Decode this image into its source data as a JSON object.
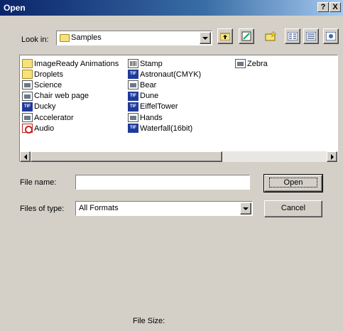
{
  "window": {
    "title": "Open",
    "help_btn": "?",
    "close_btn": "X"
  },
  "look_in": {
    "label": "Look in:",
    "value": "Samples"
  },
  "toolbar": {
    "icons": [
      "up-folder-icon",
      "desktop-icon",
      "new-folder-icon",
      "list-view-icon",
      "details-view-icon",
      "thumbnails-icon"
    ]
  },
  "files": {
    "column1": [
      {
        "name": "ImageReady Animations",
        "type": "folder"
      },
      {
        "name": "Droplets",
        "type": "folder"
      },
      {
        "name": "Science",
        "type": "doc"
      },
      {
        "name": "Chair web page",
        "type": "doc"
      },
      {
        "name": "Ducky",
        "type": "tif"
      },
      {
        "name": "Accelerator",
        "type": "doc"
      },
      {
        "name": "Audio",
        "type": "pdf"
      }
    ],
    "column2": [
      {
        "name": "Stamp",
        "type": "stamp"
      },
      {
        "name": "Astronaut(CMYK)",
        "type": "tif"
      },
      {
        "name": "Bear",
        "type": "doc"
      },
      {
        "name": "Dune",
        "type": "tif"
      },
      {
        "name": "EiffelTower",
        "type": "tif"
      },
      {
        "name": "Hands",
        "type": "doc"
      },
      {
        "name": "Waterfall(16bit)",
        "type": "tif"
      }
    ],
    "column3": [
      {
        "name": "Zebra",
        "type": "doc"
      }
    ]
  },
  "form": {
    "file_name_label": "File name:",
    "file_name_value": "",
    "file_type_label": "Files of type:",
    "file_type_value": "All Formats",
    "open_btn": "Open",
    "cancel_btn": "Cancel",
    "file_size_label": "File Size:"
  }
}
